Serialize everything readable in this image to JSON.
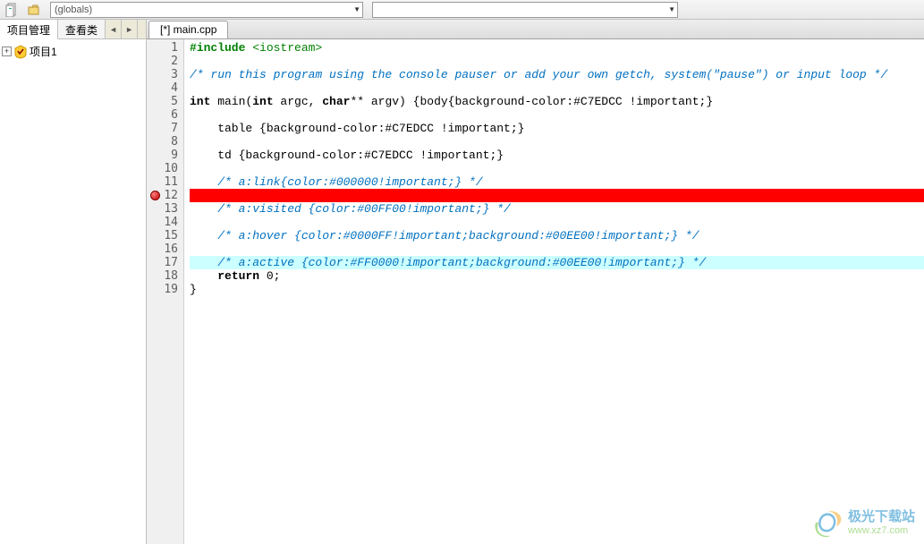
{
  "toolbar": {
    "combo1_value": "(globals)",
    "combo2_value": ""
  },
  "sidebar": {
    "tabs": {
      "manage": "项目管理",
      "classes": "查看类"
    },
    "nav_prev": "◄",
    "nav_next": "►",
    "tree": {
      "expand": "+",
      "project": "项目1"
    }
  },
  "file_tab": "[*] main.cpp",
  "code": {
    "lines": [
      {
        "n": 1,
        "type": "pp",
        "t": "#include <iostream>"
      },
      {
        "n": 2,
        "type": "blank",
        "t": ""
      },
      {
        "n": 3,
        "type": "cmt",
        "t": "/* run this program using the console pauser or add your own getch, system(\"pause\") or input loop */"
      },
      {
        "n": 4,
        "type": "blank",
        "t": ""
      },
      {
        "n": 5,
        "type": "sig",
        "kw1": "int",
        "id1": " main(",
        "kw2": "int",
        "id2": " argc, ",
        "kw3": "char",
        "id3": "** argv) {body{background-color:#C7EDCC !important;}"
      },
      {
        "n": 6,
        "type": "blank",
        "t": ""
      },
      {
        "n": 7,
        "type": "plain",
        "t": "    table {background-color:#C7EDCC !important;}"
      },
      {
        "n": 8,
        "type": "blank",
        "t": ""
      },
      {
        "n": 9,
        "type": "plain",
        "t": "    td {background-color:#C7EDCC !important;}"
      },
      {
        "n": 10,
        "type": "blank",
        "t": ""
      },
      {
        "n": 11,
        "type": "cmt",
        "t": "    /* a:link{color:#000000!important;} */"
      },
      {
        "n": 12,
        "type": "redhl",
        "t": " ",
        "bp": true
      },
      {
        "n": 13,
        "type": "cmt",
        "t": "    /* a:visited {color:#00FF00!important;} */"
      },
      {
        "n": 14,
        "type": "blank",
        "t": ""
      },
      {
        "n": 15,
        "type": "cmt",
        "t": "    /* a:hover {color:#0000FF!important;background:#00EE00!important;} */"
      },
      {
        "n": 16,
        "type": "blank",
        "t": ""
      },
      {
        "n": 17,
        "type": "cyanhl",
        "pre": "    ",
        "cmt": "/* a:active {color:#FF0000!important;background:#00EE00!important;} */"
      },
      {
        "n": 18,
        "type": "ret",
        "pre": "    ",
        "kw": "return",
        "rest": " 0;"
      },
      {
        "n": 19,
        "type": "plain",
        "t": "}"
      }
    ]
  },
  "watermark": {
    "title": "极光下载站",
    "url": "www.xz7.com"
  }
}
